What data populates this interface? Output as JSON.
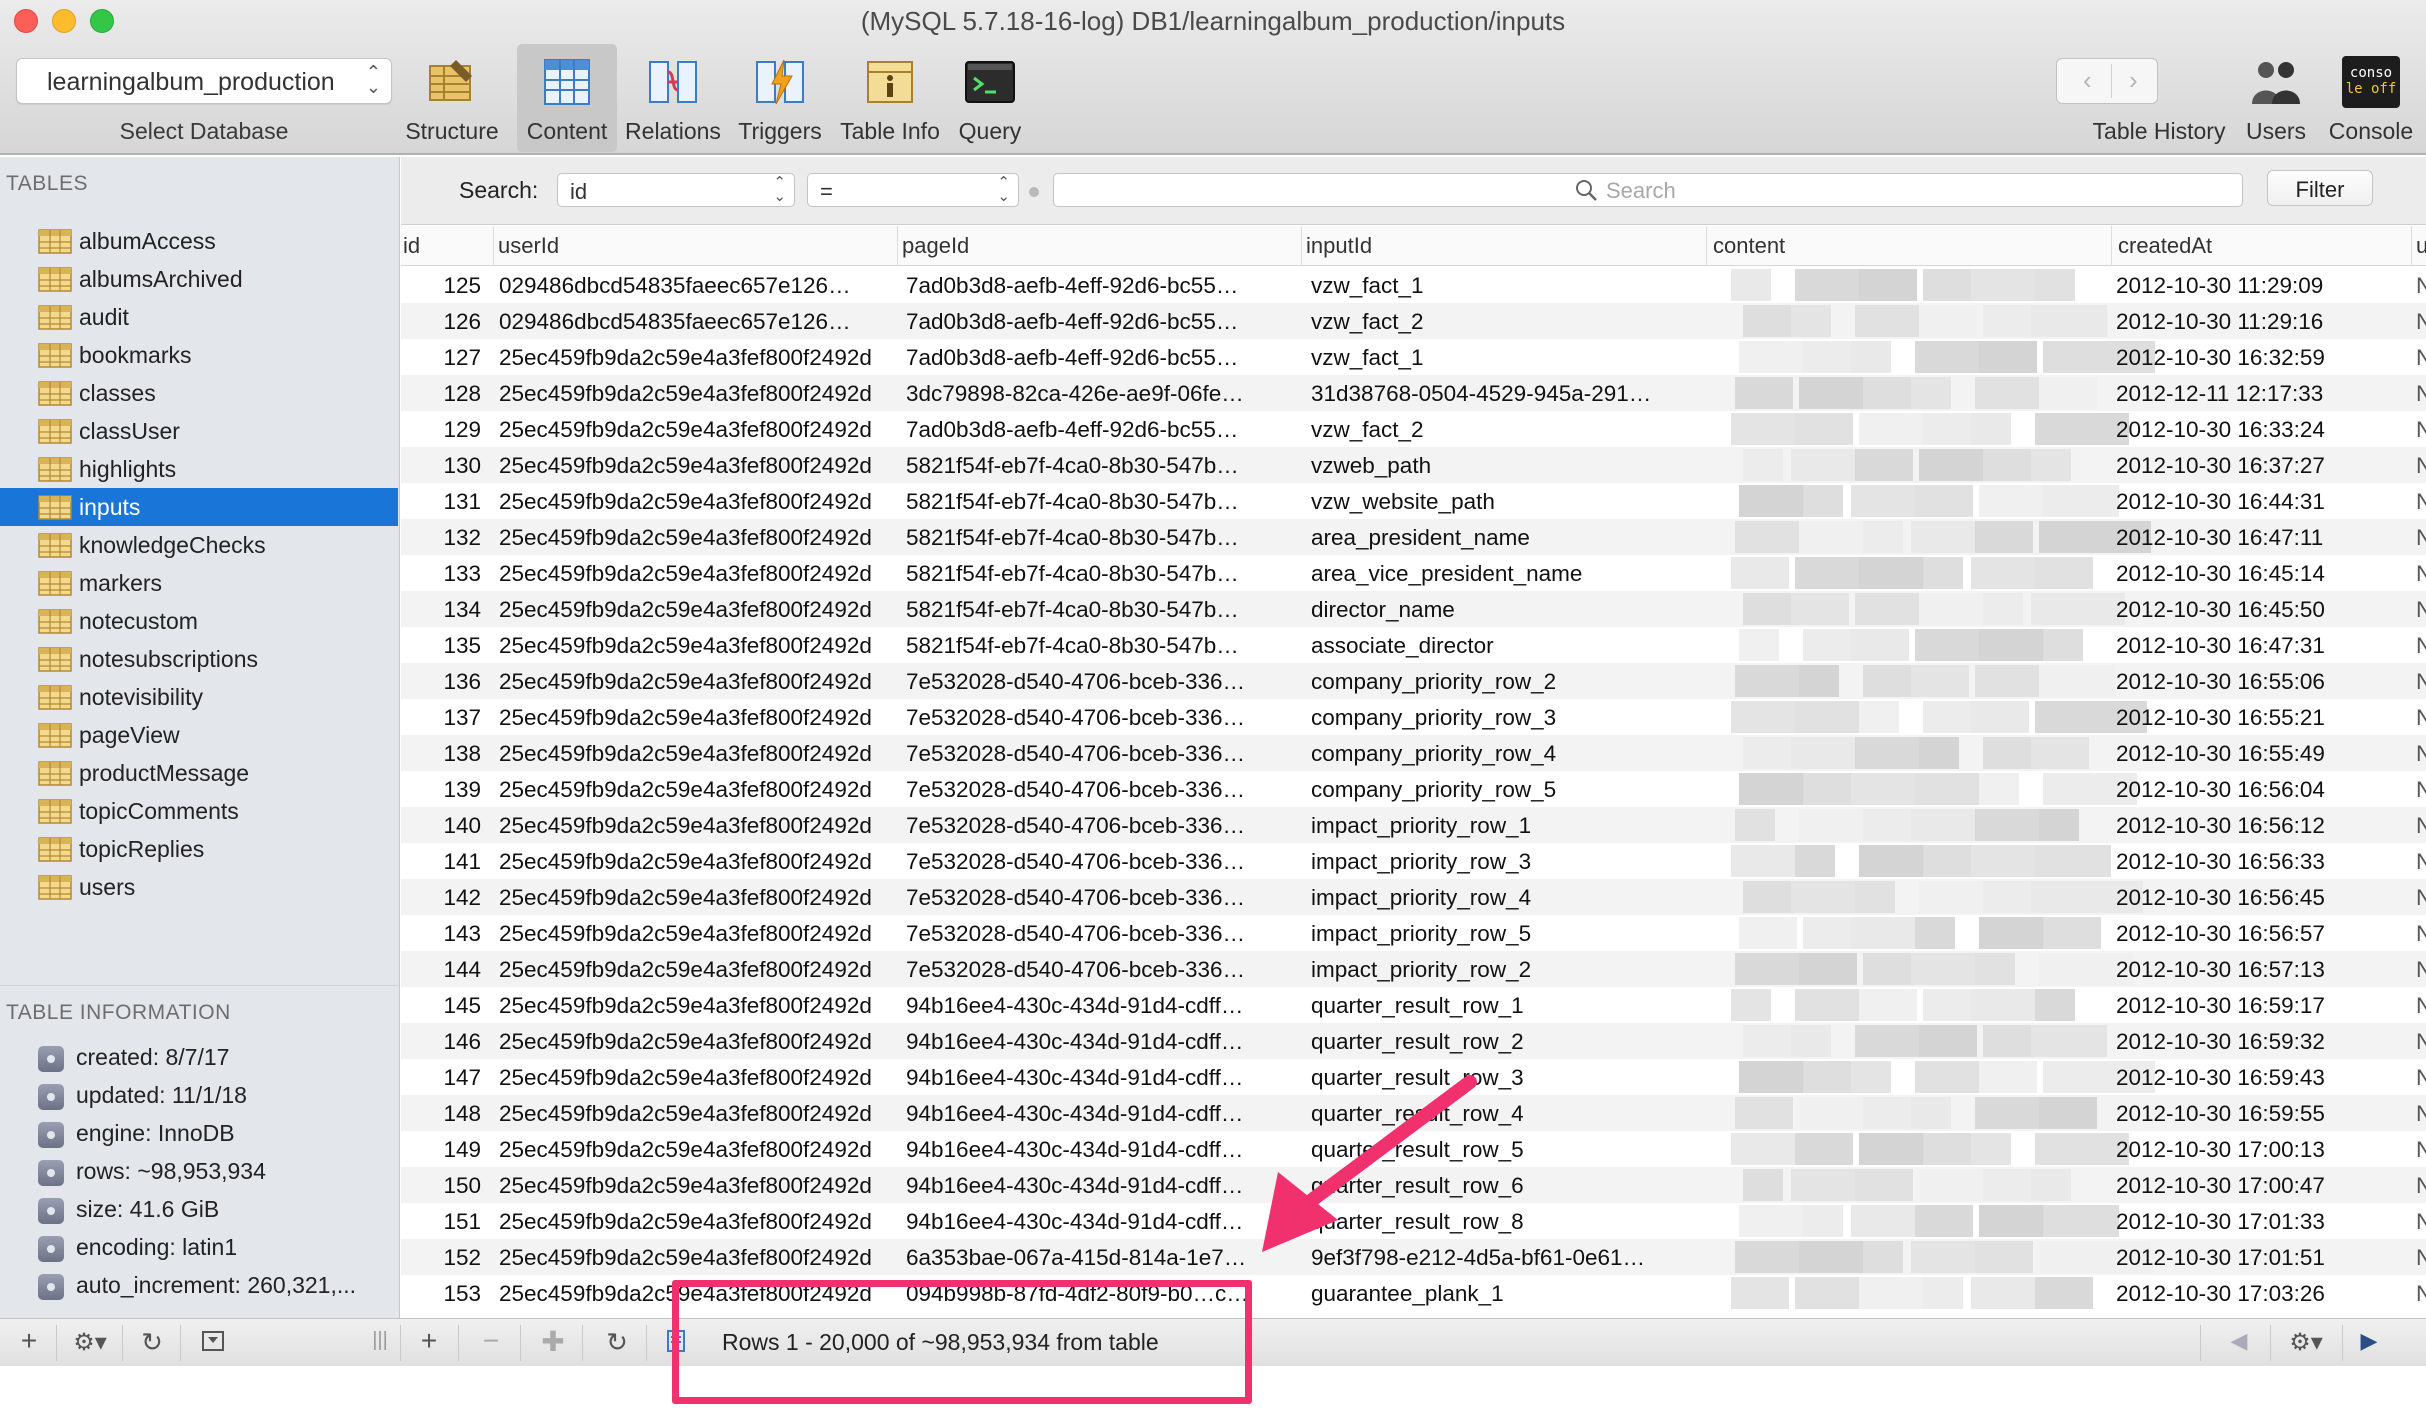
{
  "window": {
    "title": "(MySQL 5.7.18-16-log) DB1/learningalbum_production/inputs"
  },
  "toolbar": {
    "database_value": "learningalbum_production",
    "database_caption": "Select Database",
    "tools": [
      {
        "label": "Structure",
        "icon": "structure-icon"
      },
      {
        "label": "Content",
        "icon": "content-icon"
      },
      {
        "label": "Relations",
        "icon": "relations-icon"
      },
      {
        "label": "Triggers",
        "icon": "triggers-icon"
      },
      {
        "label": "Table Info",
        "icon": "table-info-icon"
      },
      {
        "label": "Query",
        "icon": "query-icon"
      }
    ],
    "active_tool": "Content",
    "right": {
      "history_label": "Table History",
      "users_label": "Users",
      "console_label": "Console",
      "console_icon_text_1": "conso",
      "console_icon_text_2": "le off"
    }
  },
  "sidebar": {
    "tables_heading": "TABLES",
    "tables": [
      "albumAccess",
      "albumsArchived",
      "audit",
      "bookmarks",
      "classes",
      "classUser",
      "highlights",
      "inputs",
      "knowledgeChecks",
      "markers",
      "notecustom",
      "notesubscriptions",
      "notevisibility",
      "pageView",
      "productMessage",
      "topicComments",
      "topicReplies",
      "users"
    ],
    "selected_table": "inputs",
    "info_heading": "TABLE INFORMATION",
    "info": [
      "created: 8/7/17",
      "updated: 11/1/18",
      "engine: InnoDB",
      "rows: ~98,953,934",
      "size: 41.6 GiB",
      "encoding: latin1",
      "auto_increment: 260,321,..."
    ]
  },
  "filter": {
    "search_label": "Search:",
    "field_value": "id",
    "operator_value": "=",
    "search_placeholder": "Search",
    "filter_button": "Filter"
  },
  "table": {
    "columns": [
      "id",
      "userId",
      "pageId",
      "inputId",
      "content",
      "createdAt",
      "u"
    ],
    "rows": [
      [
        "125",
        "029486dbcd54835faeec657e126…",
        "7ad0b3d8-aefb-4eff-92d6-bc55…",
        "vzw_fact_1",
        "2012-10-30 11:29:09"
      ],
      [
        "126",
        "029486dbcd54835faeec657e126…",
        "7ad0b3d8-aefb-4eff-92d6-bc55…",
        "vzw_fact_2",
        "2012-10-30 11:29:16"
      ],
      [
        "127",
        "25ec459fb9da2c59e4a3fef800f2492d",
        "7ad0b3d8-aefb-4eff-92d6-bc55…",
        "vzw_fact_1",
        "2012-10-30 16:32:59"
      ],
      [
        "128",
        "25ec459fb9da2c59e4a3fef800f2492d",
        "3dc79898-82ca-426e-ae9f-06fe…",
        "31d38768-0504-4529-945a-291…",
        "2012-12-11 12:17:33"
      ],
      [
        "129",
        "25ec459fb9da2c59e4a3fef800f2492d",
        "7ad0b3d8-aefb-4eff-92d6-bc55…",
        "vzw_fact_2",
        "2012-10-30 16:33:24"
      ],
      [
        "130",
        "25ec459fb9da2c59e4a3fef800f2492d",
        "5821f54f-eb7f-4ca0-8b30-547b…",
        "vzweb_path",
        "2012-10-30 16:37:27"
      ],
      [
        "131",
        "25ec459fb9da2c59e4a3fef800f2492d",
        "5821f54f-eb7f-4ca0-8b30-547b…",
        "vzw_website_path",
        "2012-10-30 16:44:31"
      ],
      [
        "132",
        "25ec459fb9da2c59e4a3fef800f2492d",
        "5821f54f-eb7f-4ca0-8b30-547b…",
        "area_president_name",
        "2012-10-30 16:47:11"
      ],
      [
        "133",
        "25ec459fb9da2c59e4a3fef800f2492d",
        "5821f54f-eb7f-4ca0-8b30-547b…",
        "area_vice_president_name",
        "2012-10-30 16:45:14"
      ],
      [
        "134",
        "25ec459fb9da2c59e4a3fef800f2492d",
        "5821f54f-eb7f-4ca0-8b30-547b…",
        "director_name",
        "2012-10-30 16:45:50"
      ],
      [
        "135",
        "25ec459fb9da2c59e4a3fef800f2492d",
        "5821f54f-eb7f-4ca0-8b30-547b…",
        "associate_director",
        "2012-10-30 16:47:31"
      ],
      [
        "136",
        "25ec459fb9da2c59e4a3fef800f2492d",
        "7e532028-d540-4706-bceb-336…",
        "company_priority_row_2",
        "2012-10-30 16:55:06"
      ],
      [
        "137",
        "25ec459fb9da2c59e4a3fef800f2492d",
        "7e532028-d540-4706-bceb-336…",
        "company_priority_row_3",
        "2012-10-30 16:55:21"
      ],
      [
        "138",
        "25ec459fb9da2c59e4a3fef800f2492d",
        "7e532028-d540-4706-bceb-336…",
        "company_priority_row_4",
        "2012-10-30 16:55:49"
      ],
      [
        "139",
        "25ec459fb9da2c59e4a3fef800f2492d",
        "7e532028-d540-4706-bceb-336…",
        "company_priority_row_5",
        "2012-10-30 16:56:04"
      ],
      [
        "140",
        "25ec459fb9da2c59e4a3fef800f2492d",
        "7e532028-d540-4706-bceb-336…",
        "impact_priority_row_1",
        "2012-10-30 16:56:12"
      ],
      [
        "141",
        "25ec459fb9da2c59e4a3fef800f2492d",
        "7e532028-d540-4706-bceb-336…",
        "impact_priority_row_3",
        "2012-10-30 16:56:33"
      ],
      [
        "142",
        "25ec459fb9da2c59e4a3fef800f2492d",
        "7e532028-d540-4706-bceb-336…",
        "impact_priority_row_4",
        "2012-10-30 16:56:45"
      ],
      [
        "143",
        "25ec459fb9da2c59e4a3fef800f2492d",
        "7e532028-d540-4706-bceb-336…",
        "impact_priority_row_5",
        "2012-10-30 16:56:57"
      ],
      [
        "144",
        "25ec459fb9da2c59e4a3fef800f2492d",
        "7e532028-d540-4706-bceb-336…",
        "impact_priority_row_2",
        "2012-10-30 16:57:13"
      ],
      [
        "145",
        "25ec459fb9da2c59e4a3fef800f2492d",
        "94b16ee4-430c-434d-91d4-cdff…",
        "quarter_result_row_1",
        "2012-10-30 16:59:17"
      ],
      [
        "146",
        "25ec459fb9da2c59e4a3fef800f2492d",
        "94b16ee4-430c-434d-91d4-cdff…",
        "quarter_result_row_2",
        "2012-10-30 16:59:32"
      ],
      [
        "147",
        "25ec459fb9da2c59e4a3fef800f2492d",
        "94b16ee4-430c-434d-91d4-cdff…",
        "quarter_result_row_3",
        "2012-10-30 16:59:43"
      ],
      [
        "148",
        "25ec459fb9da2c59e4a3fef800f2492d",
        "94b16ee4-430c-434d-91d4-cdff…",
        "quarter_result_row_4",
        "2012-10-30 16:59:55"
      ],
      [
        "149",
        "25ec459fb9da2c59e4a3fef800f2492d",
        "94b16ee4-430c-434d-91d4-cdff…",
        "quarter_result_row_5",
        "2012-10-30 17:00:13"
      ],
      [
        "150",
        "25ec459fb9da2c59e4a3fef800f2492d",
        "94b16ee4-430c-434d-91d4-cdff…",
        "quarter_result_row_6",
        "2012-10-30 17:00:47"
      ],
      [
        "151",
        "25ec459fb9da2c59e4a3fef800f2492d",
        "94b16ee4-430c-434d-91d4-cdff…",
        "quarter_result_row_8",
        "2012-10-30 17:01:33"
      ],
      [
        "152",
        "25ec459fb9da2c59e4a3fef800f2492d",
        "6a353bae-067a-415d-814a-1e7…",
        "9ef3f798-e212-4d5a-bf61-0e61…",
        "2012-10-30 17:01:51"
      ],
      [
        "153",
        "25ec459fb9da2c59e4a3fef800f2492d",
        "094b998b-87fd-4df2-80f9-b0…c…",
        "guarantee_plank_1",
        "2012-10-30 17:03:26"
      ]
    ],
    "row_edge_marks": [
      "N",
      "N",
      "N",
      "N",
      "N",
      "N",
      "N",
      "N",
      "N",
      "N",
      "N",
      "N",
      "N",
      "N",
      "N",
      "N",
      "N",
      "N",
      "N",
      "N",
      "N",
      "N",
      "N",
      "N",
      "N",
      "N",
      "N",
      "N",
      "N"
    ]
  },
  "bottombar": {
    "status": "Rows 1 - 20,000 of ~98,953,934 from table"
  },
  "colors": {
    "selection": "#1976d8",
    "annotation": "#f0316e"
  }
}
